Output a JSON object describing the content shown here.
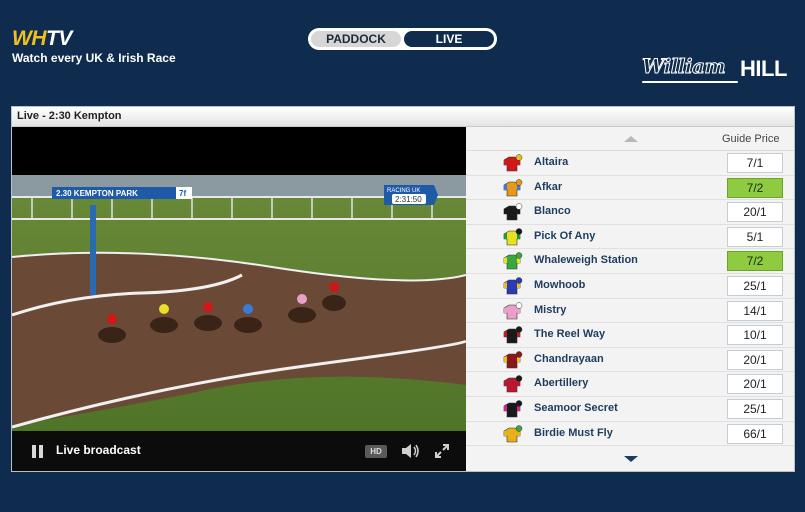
{
  "brand": {
    "logo_wh": "WH",
    "logo_tv": "TV",
    "tagline": "Watch every UK & Irish Race"
  },
  "tabs": [
    {
      "label": "PADDOCK",
      "active": false
    },
    {
      "label": "LIVE",
      "active": true
    }
  ],
  "sponsor": {
    "script": "William",
    "block": "HILL"
  },
  "panel": {
    "title": "Live - 2:30 Kempton"
  },
  "broadcast": {
    "race_caption": "2.30 KEMPTON PARK",
    "distance": "7f",
    "channel_tag": "RACING UK",
    "clock": "2:31:50",
    "status_label": "Live broadcast",
    "hd_label": "HD"
  },
  "runners_header": {
    "price_label": "Guide Price"
  },
  "runners": [
    {
      "name": "Altaira",
      "price": "7/1",
      "highlight": false,
      "silk": {
        "body": "#d01818",
        "sleeves": "#d01818",
        "cap": "#e8c018"
      }
    },
    {
      "name": "Afkar",
      "price": "7/2",
      "highlight": true,
      "silk": {
        "body": "#e89818",
        "sleeves": "#3a7ad8",
        "cap": "#e89818"
      }
    },
    {
      "name": "Blanco",
      "price": "20/1",
      "highlight": false,
      "silk": {
        "body": "#1a1a1a",
        "sleeves": "#1a1a1a",
        "cap": "#ffffff"
      }
    },
    {
      "name": "Pick Of Any",
      "price": "5/1",
      "highlight": false,
      "silk": {
        "body": "#e8e020",
        "sleeves": "#18a030",
        "cap": "#1a1a1a"
      }
    },
    {
      "name": "Whaleweigh Station",
      "price": "7/2",
      "highlight": true,
      "silk": {
        "body": "#3aa840",
        "sleeves": "#e8e020",
        "cap": "#3aa840"
      }
    },
    {
      "name": "Mowhoob",
      "price": "25/1",
      "highlight": false,
      "silk": {
        "body": "#2a3ab8",
        "sleeves": "#e8c018",
        "cap": "#2a3ab8"
      }
    },
    {
      "name": "Mistry",
      "price": "14/1",
      "highlight": false,
      "silk": {
        "body": "#e8a0c8",
        "sleeves": "#e8a0c8",
        "cap": "#ffffff"
      }
    },
    {
      "name": "The Reel Way",
      "price": "10/1",
      "highlight": false,
      "silk": {
        "body": "#1a1a1a",
        "sleeves": "#c81818",
        "cap": "#1a1a1a"
      }
    },
    {
      "name": "Chandrayaan",
      "price": "20/1",
      "highlight": false,
      "silk": {
        "body": "#8a1818",
        "sleeves": "#e8c018",
        "cap": "#8a1818"
      }
    },
    {
      "name": "Abertillery",
      "price": "20/1",
      "highlight": false,
      "silk": {
        "body": "#b81830",
        "sleeves": "#b81830",
        "cap": "#1a1a1a"
      }
    },
    {
      "name": "Seamoor Secret",
      "price": "25/1",
      "highlight": false,
      "silk": {
        "body": "#1a1a1a",
        "sleeves": "#e02090",
        "cap": "#1a1a1a"
      }
    },
    {
      "name": "Birdie Must Fly",
      "price": "66/1",
      "highlight": false,
      "silk": {
        "body": "#e8b018",
        "sleeves": "#e8b018",
        "cap": "#3aa840"
      }
    }
  ]
}
